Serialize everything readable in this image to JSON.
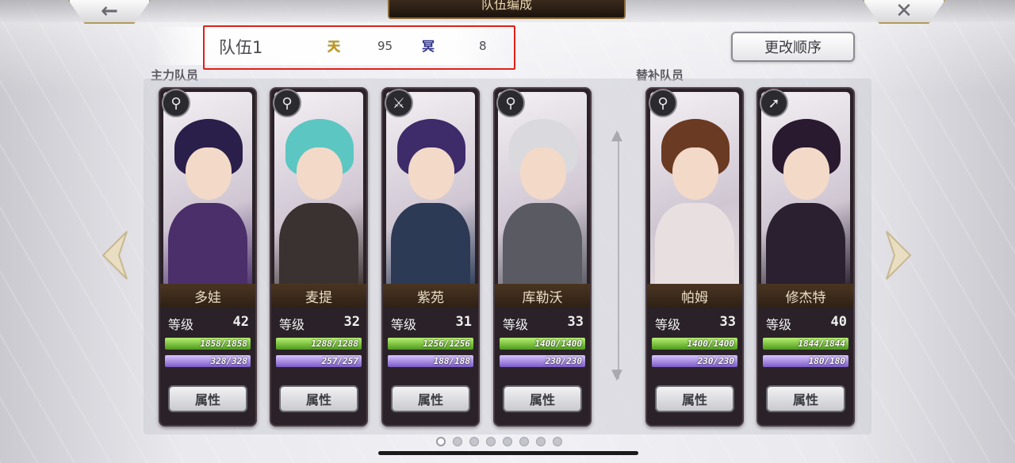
{
  "header": {
    "title": "队伍编成",
    "back_icon": "←",
    "close_icon": "✕"
  },
  "team": {
    "name": "队伍1",
    "stat1_icon": "天",
    "stat1_value": "95",
    "stat2_icon": "冥",
    "stat2_value": "8",
    "highlight_color": "#e0201a"
  },
  "reorder_label": "更改顺序",
  "sections": {
    "main": "主力队员",
    "reserve": "替补队员"
  },
  "level_label": "等级",
  "attr_label": "属性",
  "cards": [
    {
      "badge": "⚲",
      "name": "多娃",
      "level": "42",
      "hp": "1858/1858",
      "mp": "328/328",
      "hair": "#2a1f4a",
      "outfit": "#4b2f6a"
    },
    {
      "badge": "⚲",
      "name": "麦提",
      "level": "32",
      "hp": "1288/1288",
      "mp": "257/257",
      "hair": "#5cc6c2",
      "outfit": "#3a3230"
    },
    {
      "badge": "⚔",
      "name": "紫苑",
      "level": "31",
      "hp": "1256/1256",
      "mp": "188/188",
      "hair": "#3d2b6a",
      "outfit": "#2c3a55"
    },
    {
      "badge": "⚲",
      "name": "库勒沃",
      "level": "33",
      "hp": "1400/1400",
      "mp": "230/230",
      "hair": "#d9d9de",
      "outfit": "#5a5a62"
    },
    {
      "badge": "⚲",
      "name": "帕姆",
      "level": "33",
      "hp": "1400/1400",
      "mp": "230/230",
      "hair": "#6a3a22",
      "outfit": "#e8e0e0"
    },
    {
      "badge": "➚",
      "name": "修杰特",
      "level": "40",
      "hp": "1844/1844",
      "mp": "180/180",
      "hair": "#2a1a30",
      "outfit": "#2a2030"
    }
  ],
  "pager": {
    "count": 8,
    "active": 1
  }
}
